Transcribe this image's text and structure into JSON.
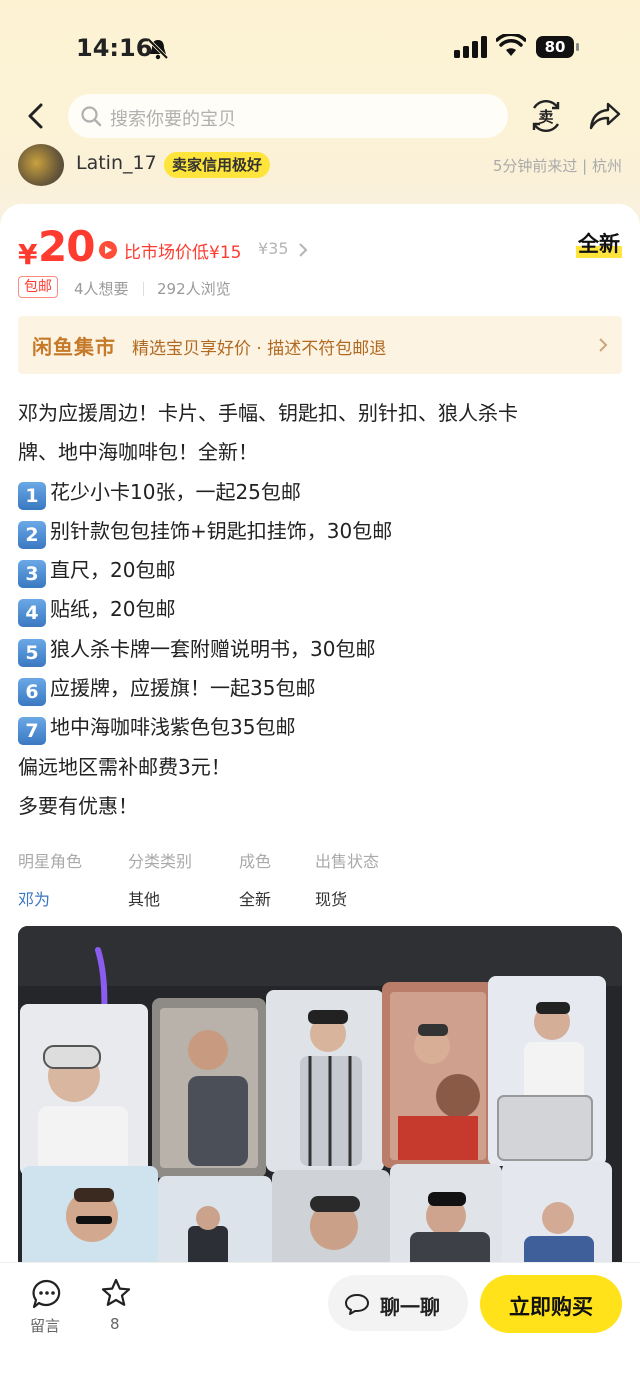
{
  "status_bar": {
    "time": "14:16",
    "battery": "80"
  },
  "nav": {
    "search_placeholder": "搜索你要的宝贝",
    "sell_label": "卖"
  },
  "seller": {
    "name": "Latin_17",
    "credit_badge": "卖家信用极好",
    "last_seen": "5分钟前来过 | 杭州"
  },
  "price": {
    "currency": "¥",
    "amount": "20",
    "compare_text": "比市场价低¥15",
    "market_price": "¥35",
    "condition_badge": "全新"
  },
  "stats": {
    "free_shipping": "包邮",
    "wants": "4人想要",
    "views": "292人浏览"
  },
  "banner": {
    "logo": "闲鱼集市",
    "text": "精选宝贝享好价 · 描述不符包邮退"
  },
  "description": {
    "lines": [
      "邓为应援周边！卡片、手幅、钥匙扣、别针扣、狼人杀卡",
      "牌、地中海咖啡包！全新！"
    ],
    "items": [
      {
        "num": "1",
        "text": "花少小卡10张，一起25包邮"
      },
      {
        "num": "2",
        "text": "别针款包包挂饰+钥匙扣挂饰，30包邮"
      },
      {
        "num": "3",
        "text": "直尺，20包邮"
      },
      {
        "num": "4",
        "text": "贴纸，20包邮"
      },
      {
        "num": "5",
        "text": "狼人杀卡牌一套附赠说明书，30包邮"
      },
      {
        "num": "6",
        "text": "应援牌，应援旗！一起35包邮"
      },
      {
        "num": "7",
        "text": "地中海咖啡浅紫色包35包邮"
      }
    ],
    "footer": [
      "偏远地区需补邮费3元！",
      "多要有优惠！"
    ]
  },
  "properties": [
    {
      "label": "明星角色",
      "value": "邓为"
    },
    {
      "label": "分类类别",
      "value": "其他"
    },
    {
      "label": "成色",
      "value": "全新"
    },
    {
      "label": "出售状态",
      "value": "现货"
    }
  ],
  "bottom_bar": {
    "comment_label": "留言",
    "favorites_count": "8",
    "chat_label": "聊一聊",
    "buy_label": "立即购买"
  },
  "colors": {
    "price_red": "#ff3b30",
    "brand_yellow": "#ffe21a",
    "link_blue": "#3b76c4"
  }
}
